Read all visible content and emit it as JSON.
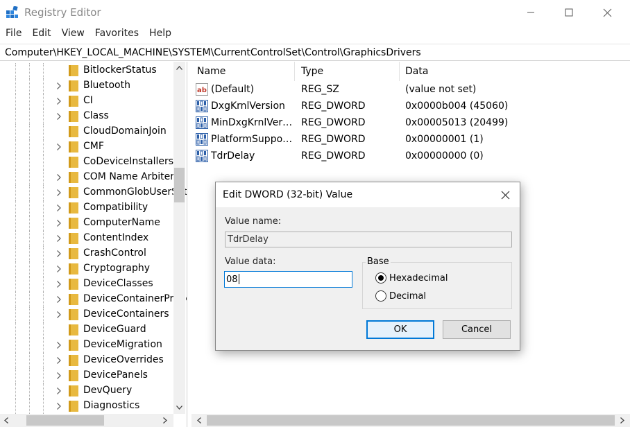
{
  "window": {
    "title": "Registry Editor",
    "minimize_glyph": "—",
    "maximize_glyph": "☐",
    "close_glyph": "✕"
  },
  "menu": [
    "File",
    "Edit",
    "View",
    "Favorites",
    "Help"
  ],
  "address": "Computer\\HKEY_LOCAL_MACHINE\\SYSTEM\\CurrentControlSet\\Control\\GraphicsDrivers",
  "tree": {
    "items": [
      {
        "label": "BitlockerStatus",
        "expandable": false
      },
      {
        "label": "Bluetooth",
        "expandable": true
      },
      {
        "label": "CI",
        "expandable": true
      },
      {
        "label": "Class",
        "expandable": true
      },
      {
        "label": "CloudDomainJoin",
        "expandable": false
      },
      {
        "label": "CMF",
        "expandable": true
      },
      {
        "label": "CoDeviceInstallers",
        "expandable": false
      },
      {
        "label": "COM Name Arbiter",
        "expandable": true
      },
      {
        "label": "CommonGlobUserSettings",
        "expandable": true
      },
      {
        "label": "Compatibility",
        "expandable": true
      },
      {
        "label": "ComputerName",
        "expandable": true
      },
      {
        "label": "ContentIndex",
        "expandable": true
      },
      {
        "label": "CrashControl",
        "expandable": true
      },
      {
        "label": "Cryptography",
        "expandable": true
      },
      {
        "label": "DeviceClasses",
        "expandable": true
      },
      {
        "label": "DeviceContainerPropertyUpdateEvents",
        "expandable": true
      },
      {
        "label": "DeviceContainers",
        "expandable": true
      },
      {
        "label": "DeviceGuard",
        "expandable": false
      },
      {
        "label": "DeviceMigration",
        "expandable": true
      },
      {
        "label": "DeviceOverrides",
        "expandable": true
      },
      {
        "label": "DevicePanels",
        "expandable": true
      },
      {
        "label": "DevQuery",
        "expandable": true
      },
      {
        "label": "Diagnostics",
        "expandable": true
      }
    ]
  },
  "columns": {
    "name": "Name",
    "type": "Type",
    "data": "Data"
  },
  "values": [
    {
      "name": "(Default)",
      "type": "REG_SZ",
      "data": "(value not set)",
      "icon": "string-value-icon"
    },
    {
      "name": "DxgKrnlVersion",
      "type": "REG_DWORD",
      "data": "0x0000b004 (45060)",
      "icon": "binary-value-icon"
    },
    {
      "name": "MinDxgKrnlVersion",
      "type": "REG_DWORD",
      "data": "0x00005013 (20499)",
      "icon": "binary-value-icon"
    },
    {
      "name": "PlatformSupportMiracast",
      "type": "REG_DWORD",
      "data": "0x00000001 (1)",
      "icon": "binary-value-icon"
    },
    {
      "name": "TdrDelay",
      "type": "REG_DWORD",
      "data": "0x00000000 (0)",
      "icon": "binary-value-icon"
    }
  ],
  "dialog": {
    "title": "Edit DWORD (32-bit) Value",
    "value_name_label": "Value name:",
    "value_name": "TdrDelay",
    "value_data_label": "Value data:",
    "value_data": "08",
    "base_label": "Base",
    "hex_label": "Hexadecimal",
    "dec_label": "Decimal",
    "selected_base": "Hexadecimal",
    "ok_label": "OK",
    "cancel_label": "Cancel",
    "close_glyph": "✕"
  },
  "colors": {
    "accent": "#0078d7",
    "folder": "#e8b940",
    "folder_dark": "#d19a1a"
  }
}
